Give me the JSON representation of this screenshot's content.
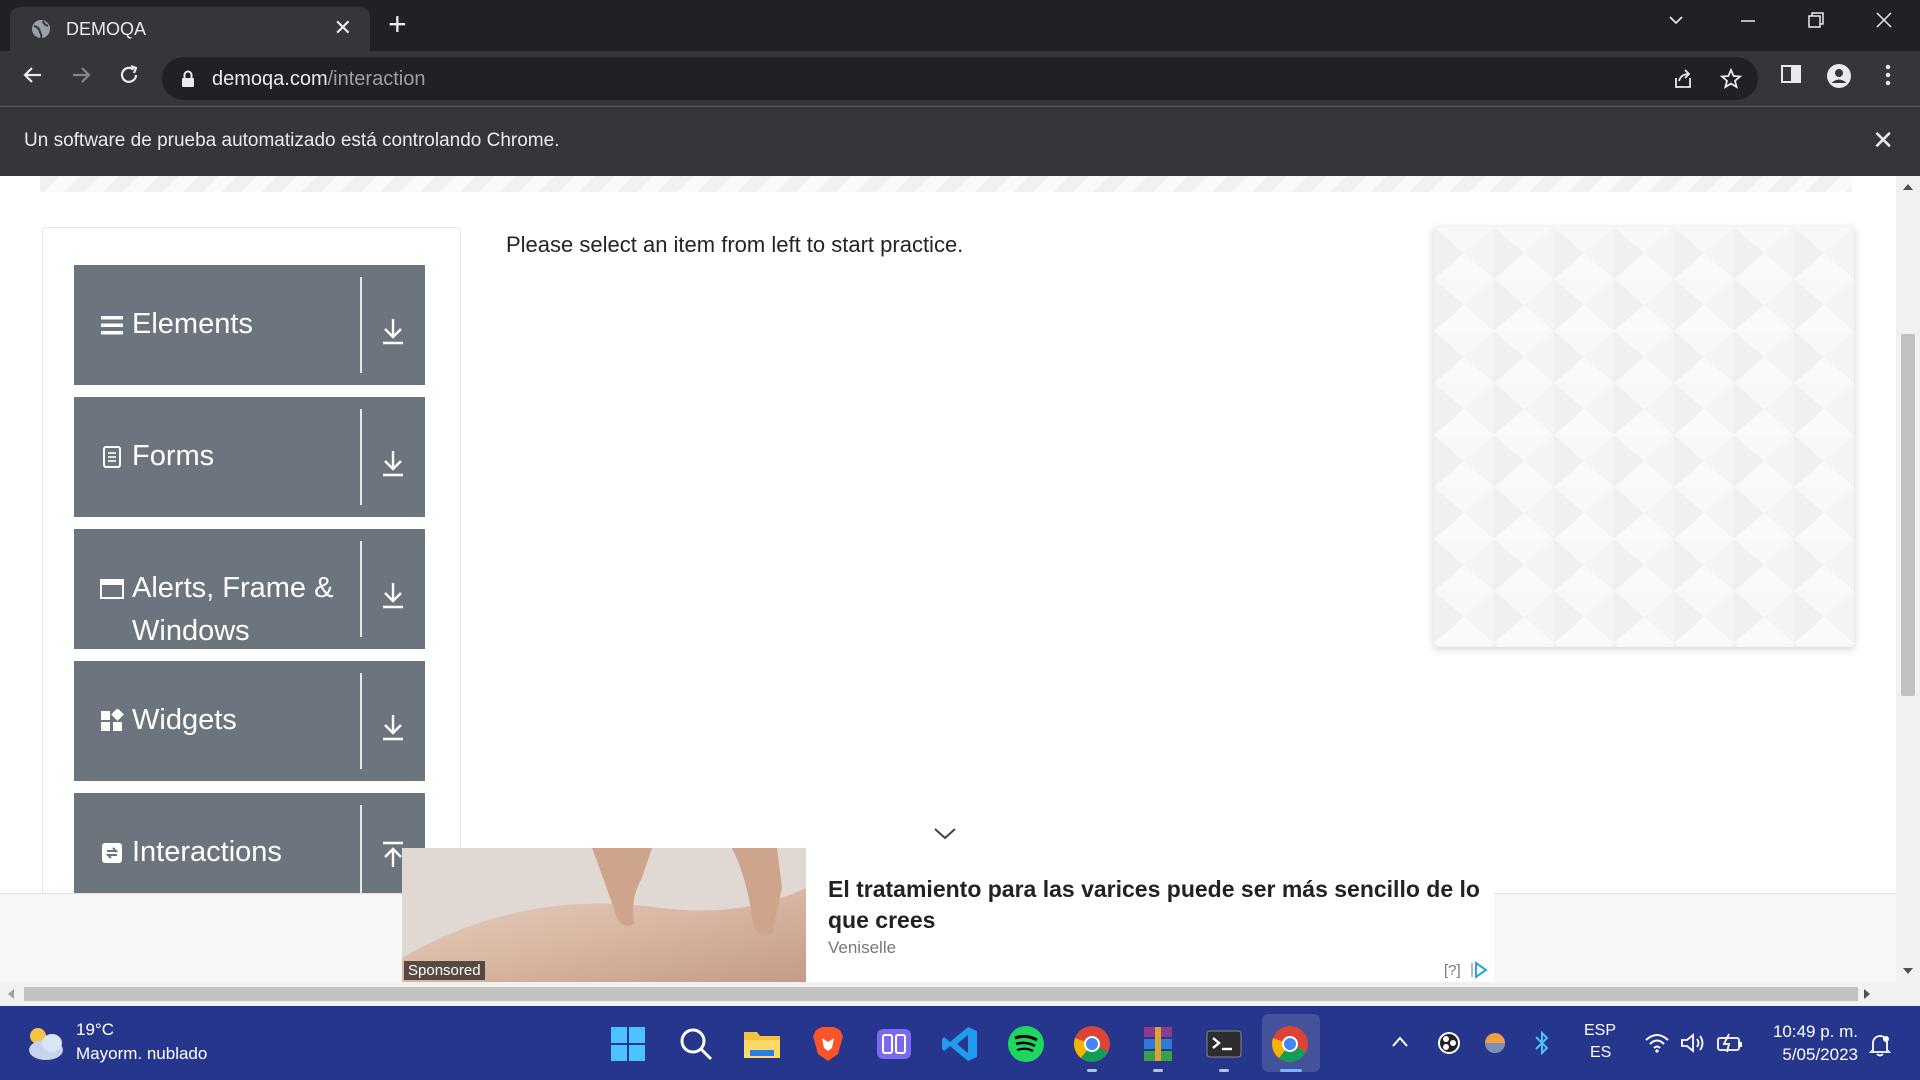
{
  "browser": {
    "tab_title": "DEMOQA",
    "url_host": "demoqa.com",
    "url_path": "/interaction",
    "infobar_message": "Un software de prueba automatizado está controlando Chrome."
  },
  "sidebar": {
    "groups": [
      {
        "label_line1": "Elements",
        "label_line2": "",
        "icon": "list-icon"
      },
      {
        "label_line1": "Forms",
        "label_line2": "",
        "icon": "form-icon"
      },
      {
        "label_line1": "Alerts, Frame &",
        "label_line2": "Windows",
        "icon": "window-icon"
      },
      {
        "label_line1": "Widgets",
        "label_line2": "",
        "icon": "widgets-icon"
      },
      {
        "label_line1": "Interactions",
        "label_line2": "",
        "icon": "interactions-icon"
      }
    ]
  },
  "main": {
    "instruction": "Please select an item from left to start practice."
  },
  "ad": {
    "title": "El tratamiento para las varices puede ser más sencillo de lo que crees",
    "source": "Veniselle",
    "sponsored_label": "Sponsored",
    "info_label": "[?]"
  },
  "taskbar": {
    "temperature": "19°C",
    "weather": "Mayorm. nublado",
    "lang_line1": "ESP",
    "lang_line2": "ES",
    "time": "10:49 p. m.",
    "date": "5/05/2023"
  }
}
